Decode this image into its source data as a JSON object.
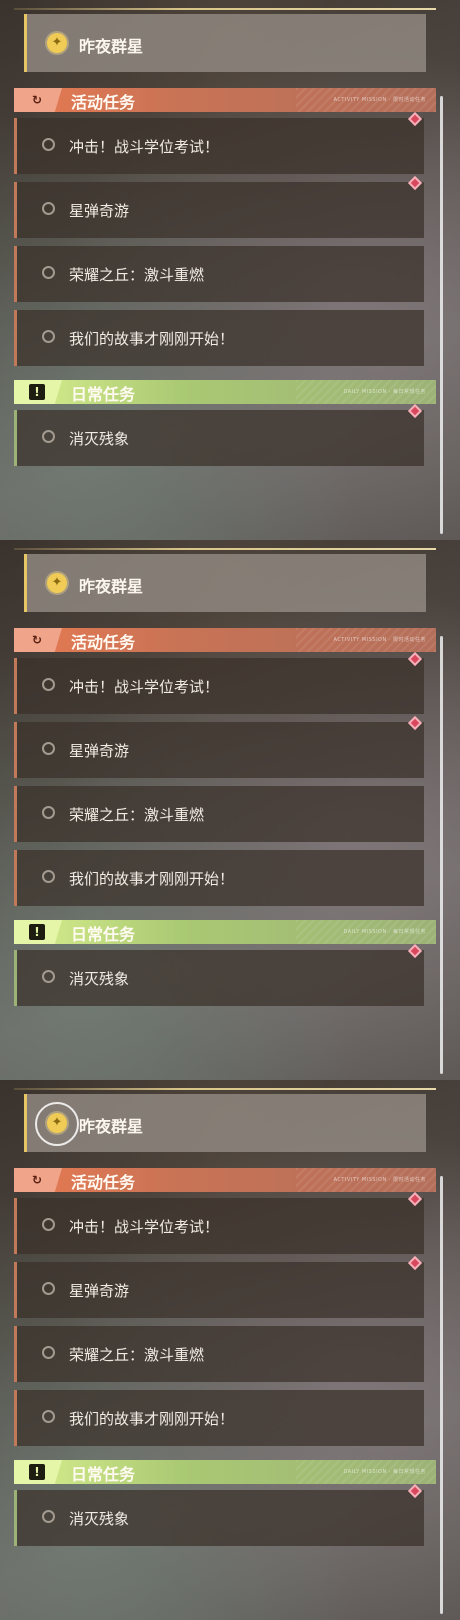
{
  "pinned": {
    "title": "昨夜群星",
    "icon": "compass-star-icon",
    "accent": "#e6c766"
  },
  "categories": {
    "activity": {
      "title": "活动任务",
      "icon": "refresh-icon",
      "tag": "ACTIVITY MISSION · 限时活动任务",
      "color": "#e77a52"
    },
    "daily": {
      "title": "日常任务",
      "icon": "alert-icon",
      "tag": "DAILY MISSION · 每日常规任务",
      "color": "#d8ef8e"
    }
  },
  "tasks": {
    "activity": [
      {
        "label": "冲击！战斗学位考试！"
      },
      {
        "label": "星弹奇游"
      },
      {
        "label": "荣耀之丘：激斗重燃"
      },
      {
        "label": "我们的故事才刚刚开始！"
      }
    ],
    "daily": [
      {
        "label": "消灭残象"
      }
    ]
  },
  "marker_color": "#d9475d",
  "frames": [
    {
      "selected": false
    },
    {
      "selected": false
    },
    {
      "selected": true
    }
  ]
}
